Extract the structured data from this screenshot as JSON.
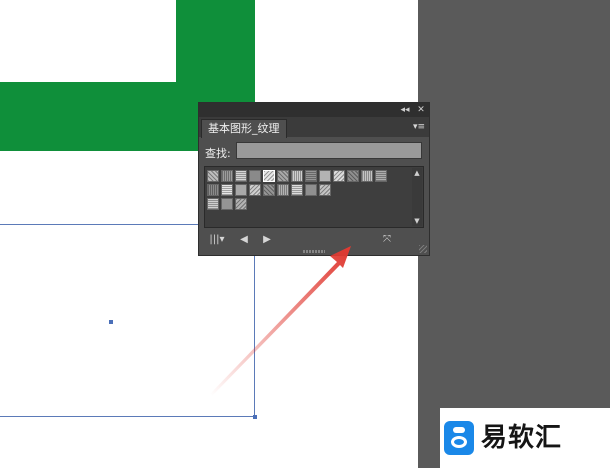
{
  "panel": {
    "tab_title": "基本图形_纹理",
    "collapse_icon": "double-left-chevron-icon",
    "close_icon": "close-icon",
    "menu_icon": "panel-menu-icon",
    "search_label": "查找:",
    "search_value": "",
    "bottom": {
      "library_icon": "library-menu-icon",
      "prev_icon": "previous-icon",
      "next_icon": "next-icon",
      "break_link_icon": "break-link-icon"
    },
    "swatches": {
      "count": 25,
      "row1": 13,
      "row2": 9,
      "row3": 3
    }
  },
  "colors": {
    "accent_green": "#0f8f3a",
    "panel_bg": "#4f4f4f",
    "pasteboard": "#5a5a5a",
    "arrow_red": "#e03a32",
    "logo_blue": "#1a88e8"
  },
  "logo": {
    "text": "易软汇"
  }
}
